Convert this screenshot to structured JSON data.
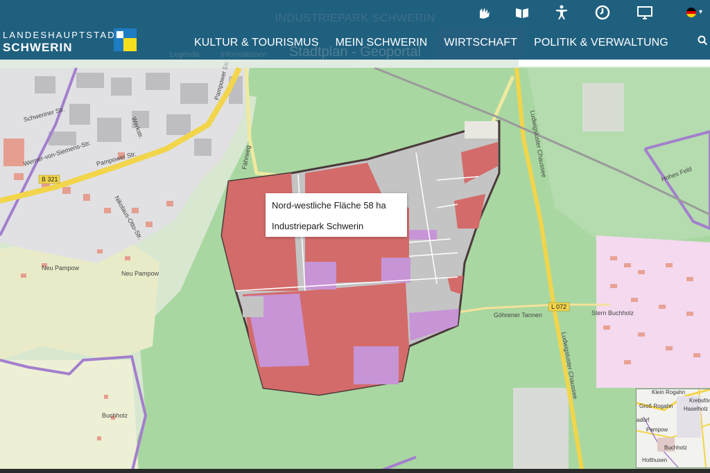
{
  "site": {
    "logo_line1": "LANDESHAUPTSTADT",
    "logo_line2": "SCHWERIN",
    "bg_title": "INDUSTRIEPARK SCHWERIN",
    "bg_subtitle": "Stadtplan - Geoportal",
    "bg_toolbar": [
      "Legende",
      "Informationen"
    ]
  },
  "nav": {
    "items": [
      {
        "label": "KULTUR & TOURISMUS",
        "active": false
      },
      {
        "label": "MEIN SCHWERIN",
        "active": false
      },
      {
        "label": "WIRTSCHAFT",
        "active": true
      },
      {
        "label": "POLITIK & VERWALTUNG",
        "active": false
      }
    ]
  },
  "utility_icons": [
    "sign-language-icon",
    "easy-language-icon",
    "accessibility-icon",
    "clock-icon",
    "monitor-icon"
  ],
  "language": {
    "flag": "de"
  },
  "popup": {
    "line1": "Nord-westliche Fläche 58 ha",
    "line2": "Industriepark Schwerin"
  },
  "map_labels": {
    "schweriner_str": "Schweriner Str.",
    "werkstr": "Werkstr.",
    "pampower_str": "Pampower Str.",
    "pampower_str2": "Pampower Str.",
    "werner_siemens": "Werner-von-Siemens-Str.",
    "b321": "B 321",
    "nikolaus_otto": "Nikolaus-Otto-Str.",
    "neu_pampow": "Neu Pampow",
    "neu_pampow2": "Neu Pampow",
    "buchholz": "Buchholz",
    "goehrener_tannen": "Göhrener Tannen",
    "l072": "L 072",
    "stern_buchholz": "Stern Buchholz",
    "ludwigsluster1": "Ludwigsluster Chaussee",
    "ludwigsluster2": "Ludwigsluster Chaussee",
    "hohes_feld": "Hohes Feld",
    "faehrweg": "Fährweg"
  },
  "overview_labels": {
    "a": "Klein Rogahn",
    "b": "Krebsförden",
    "c": "Groß Rogahn",
    "d": "Haselholz",
    "e": "Pampow",
    "f": "Buchholz",
    "g": "Holthusen",
    "h": "adorf"
  },
  "colors": {
    "header": "#1a5b7c",
    "forest": "#a9d7a2",
    "parcel_red": "#d36b6a",
    "parcel_purple": "#c794d6",
    "parcel_grey": "#c4c4c4",
    "boundary": "#a37fcd",
    "road_yellow": "#f2d54a"
  }
}
